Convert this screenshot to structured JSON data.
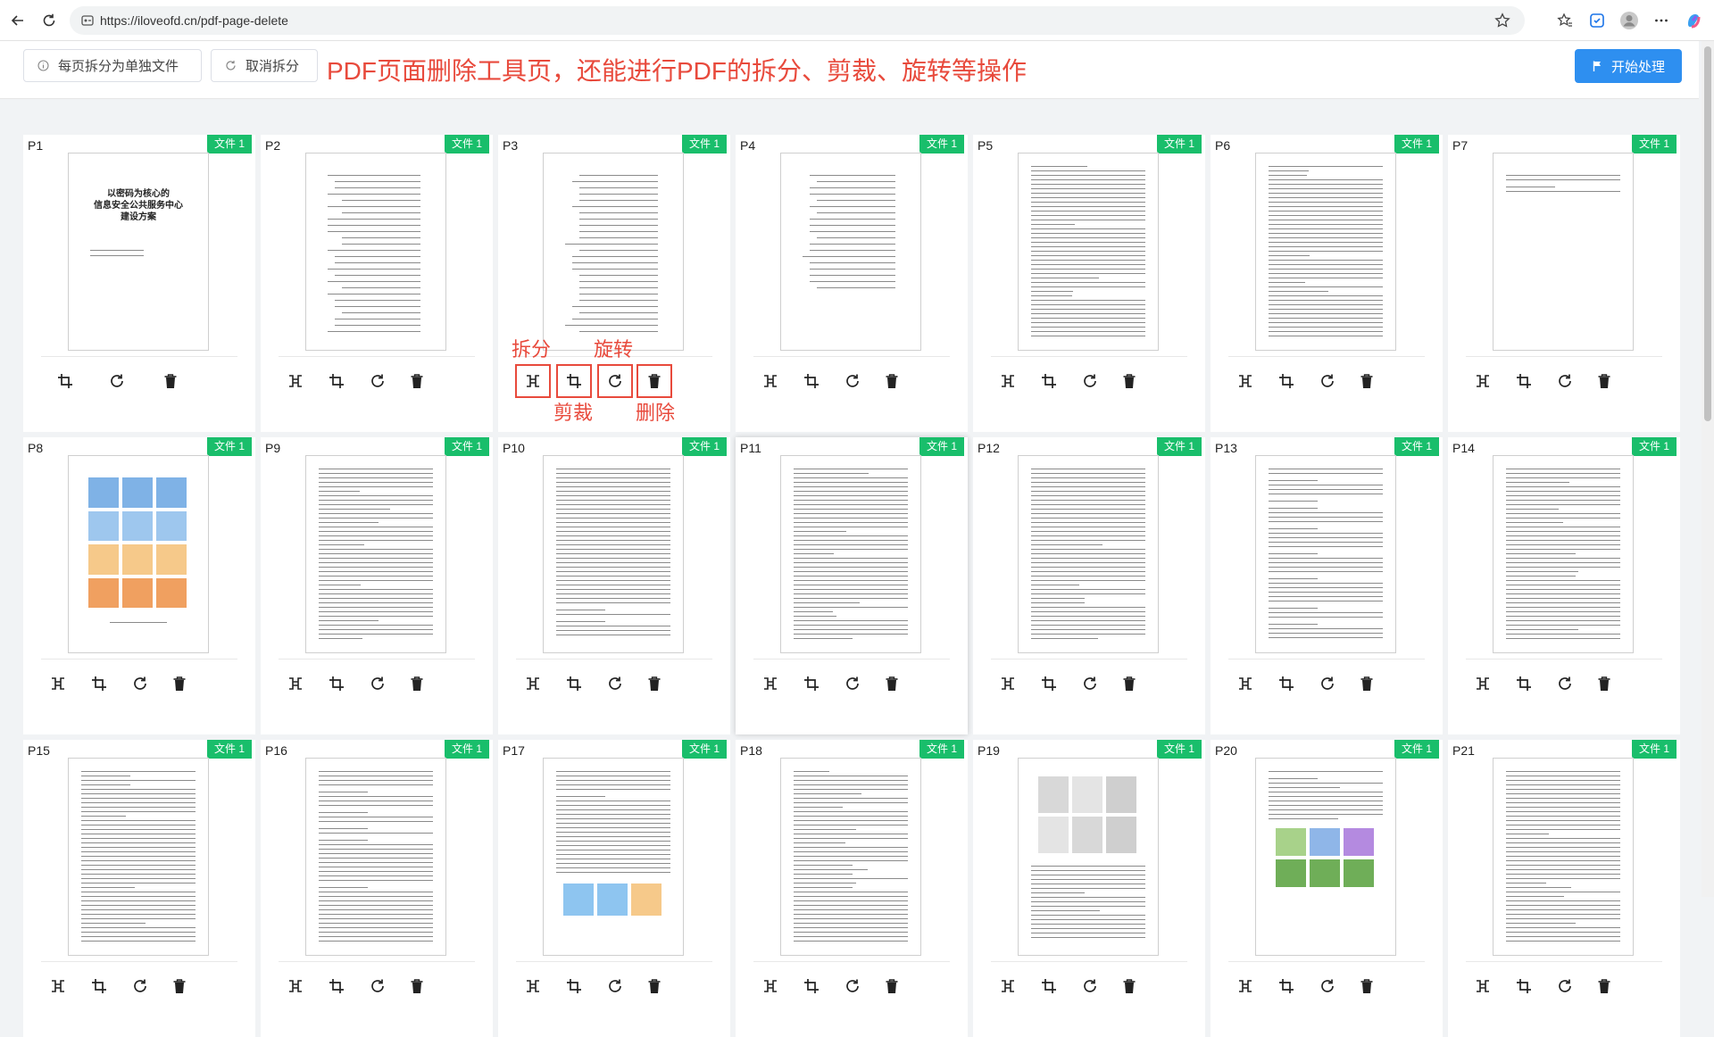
{
  "browser": {
    "url": "https://iloveofd.cn/pdf-page-delete"
  },
  "toolbar": {
    "split_each_label": "每页拆分为单独文件",
    "cancel_split_label": "取消拆分",
    "banner_text": "PDF页面删除工具页，还能进行PDF的拆分、剪裁、旋转等操作",
    "start_label": "开始处理"
  },
  "annotations": {
    "split": "拆分",
    "crop": "剪裁",
    "rotate": "旋转",
    "delete": "删除"
  },
  "p1_cover": {
    "line1": "以密码为核心的",
    "line2": "信息安全公共服务中心",
    "line3": "建设方案"
  },
  "pages": [
    {
      "label": "P1",
      "badge": "文件 1"
    },
    {
      "label": "P2",
      "badge": "文件 1"
    },
    {
      "label": "P3",
      "badge": "文件 1"
    },
    {
      "label": "P4",
      "badge": "文件 1"
    },
    {
      "label": "P5",
      "badge": "文件 1"
    },
    {
      "label": "P6",
      "badge": "文件 1"
    },
    {
      "label": "P7",
      "badge": "文件 1"
    },
    {
      "label": "P8",
      "badge": "文件 1"
    },
    {
      "label": "P9",
      "badge": "文件 1"
    },
    {
      "label": "P10",
      "badge": "文件 1"
    },
    {
      "label": "P11",
      "badge": "文件 1"
    },
    {
      "label": "P12",
      "badge": "文件 1"
    },
    {
      "label": "P13",
      "badge": "文件 1"
    },
    {
      "label": "P14",
      "badge": "文件 1"
    },
    {
      "label": "P15",
      "badge": "文件 1"
    },
    {
      "label": "P16",
      "badge": "文件 1"
    },
    {
      "label": "P17",
      "badge": "文件 1"
    },
    {
      "label": "P18",
      "badge": "文件 1"
    },
    {
      "label": "P19",
      "badge": "文件 1"
    },
    {
      "label": "P20",
      "badge": "文件 1"
    },
    {
      "label": "P21",
      "badge": "文件 1"
    }
  ],
  "icons": {
    "split": "split-icon",
    "crop": "crop-icon",
    "rotate": "rotate-icon",
    "delete": "trash-icon"
  },
  "colors": {
    "accent": "#2e8ff0",
    "badge": "#19be6b",
    "annotation": "#e84a3c"
  }
}
